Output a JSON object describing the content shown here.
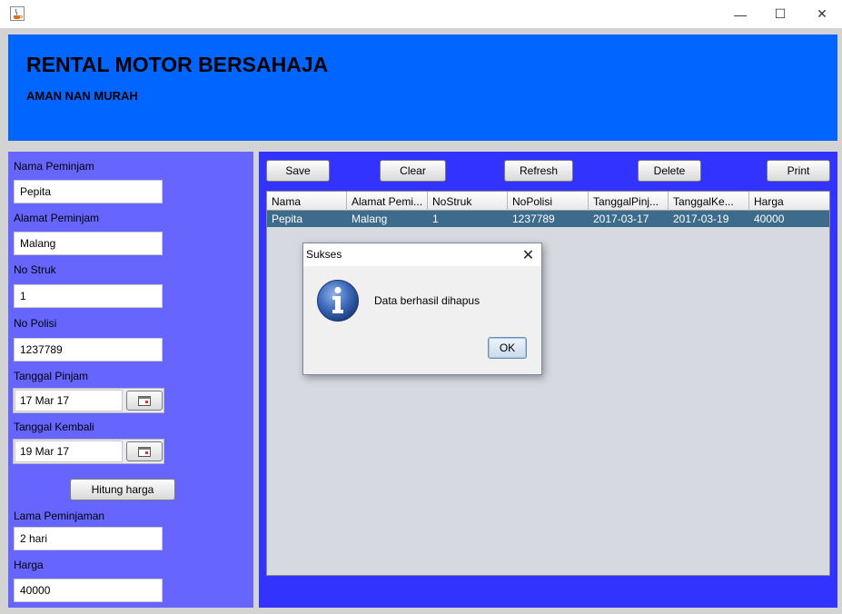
{
  "window": {
    "title": "",
    "icon": "java-cup-icon",
    "controls": {
      "minimize": "—",
      "maximize": "☐",
      "close": "✕"
    }
  },
  "header": {
    "title": "RENTAL MOTOR BERSAHAJA",
    "subtitle": "AMAN NAN MURAH",
    "color": "#0066ff"
  },
  "form": {
    "nama_label": "Nama Peminjam",
    "nama_value": "Pepita",
    "alamat_label": "Alamat Peminjam",
    "alamat_value": "Malang",
    "nostruk_label": "No Struk",
    "nostruk_value": "1",
    "nopolisi_label": "No Polisi",
    "nopolisi_value": "1237789",
    "tglpinjam_label": "Tanggal Pinjam",
    "tglpinjam_value": "17 Mar 17",
    "tglkembali_label": "Tanggal Kembali",
    "tglkembali_value": "19 Mar 17",
    "hitung_label": "Hitung harga",
    "lama_label": "Lama Peminjaman",
    "lama_value": "2 hari",
    "harga_label": "Harga",
    "harga_value": "40000",
    "panel_color": "#6666ff"
  },
  "toolbar": {
    "save": "Save",
    "clear": "Clear",
    "refresh": "Refresh",
    "delete": "Delete",
    "print": "Print",
    "panel_color": "#3333ff"
  },
  "table": {
    "columns": [
      "Nama",
      "Alamat Pemi...",
      "NoStruk",
      "NoPolisi",
      "TanggalPinj...",
      "TanggalKe...",
      "Harga"
    ],
    "rows": [
      [
        "Pepita",
        "Malang",
        "1",
        "1237789",
        "2017-03-17",
        "2017-03-19",
        "40000"
      ]
    ],
    "selected_row_color": "#3d6b8c"
  },
  "dialog": {
    "title": "Sukses",
    "message": "Data berhasil dihapus",
    "ok": "OK",
    "close": "✕",
    "icon": "info-icon"
  }
}
